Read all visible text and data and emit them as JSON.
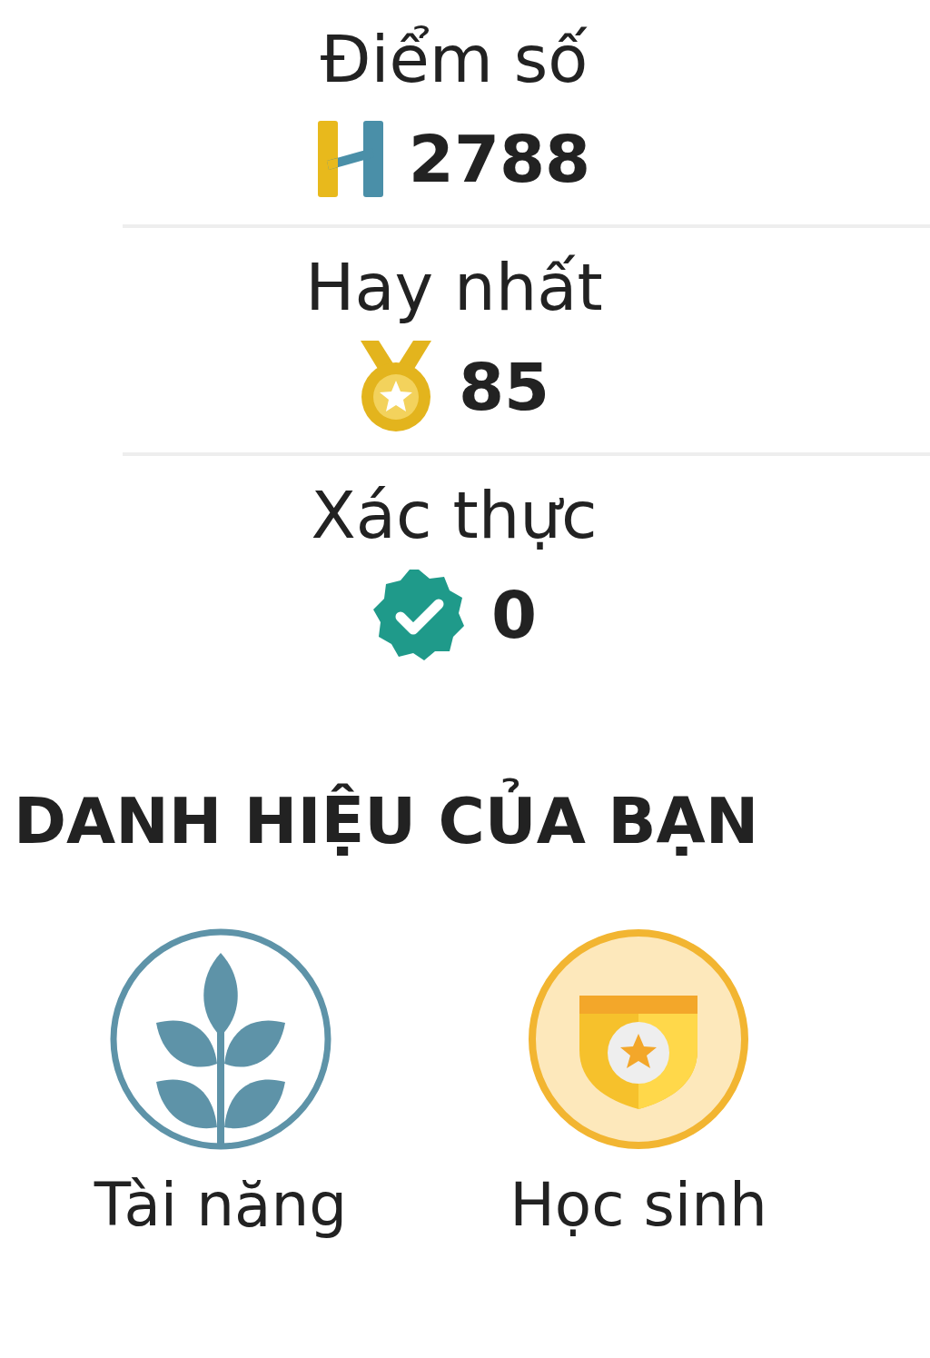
{
  "stats": [
    {
      "kind": "score",
      "label": "Điểm số",
      "value": "2788"
    },
    {
      "kind": "best",
      "label": "Hay nhất",
      "value": "85"
    },
    {
      "kind": "verified",
      "label": "Xác thực",
      "value": "0"
    }
  ],
  "titles_heading": "DANH HIỆU CỦA BẠN",
  "titles": [
    {
      "kind": "talent",
      "label": "Tài năng"
    },
    {
      "kind": "student",
      "label": "Học sinh"
    }
  ]
}
